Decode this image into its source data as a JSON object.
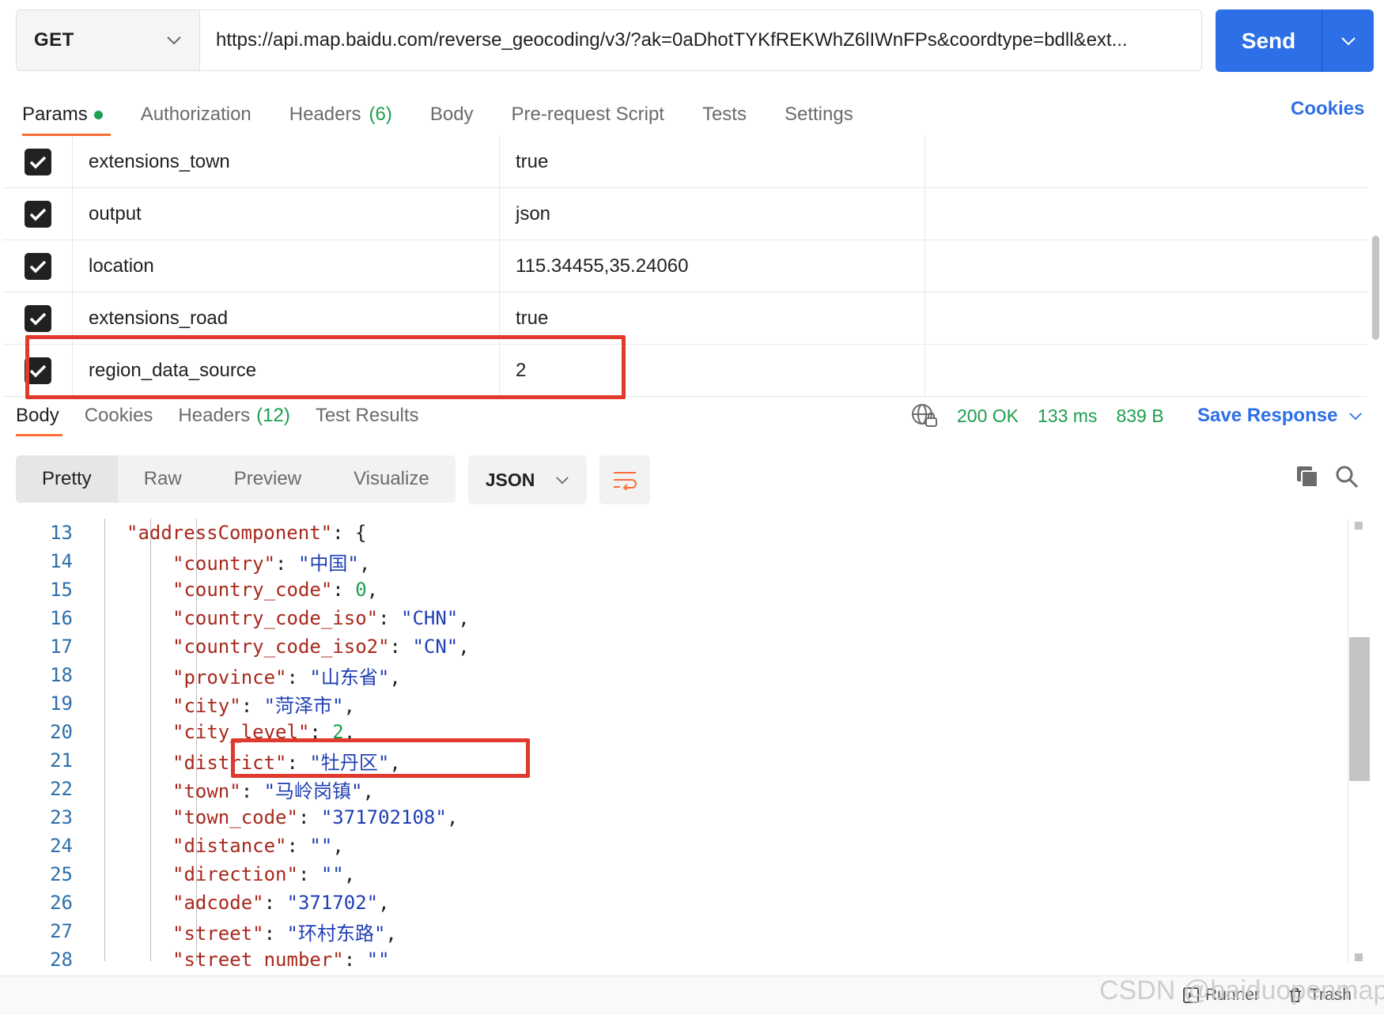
{
  "request": {
    "method": "GET",
    "url": "https://api.map.baidu.com/reverse_geocoding/v3/?ak=0aDhotTYKfREKWhZ6lIWnFPs&coordtype=bdll&ext...",
    "send_label": "Send"
  },
  "request_tabs": [
    {
      "label": "Params",
      "active": true
    },
    {
      "label": "Authorization"
    },
    {
      "label": "Headers",
      "count": "(6)"
    },
    {
      "label": "Body"
    },
    {
      "label": "Pre-request Script"
    },
    {
      "label": "Tests"
    },
    {
      "label": "Settings"
    }
  ],
  "cookies_link": "Cookies",
  "params": [
    {
      "key": "extensions_town",
      "value": "true",
      "checked": true
    },
    {
      "key": "output",
      "value": "json",
      "checked": true
    },
    {
      "key": "location",
      "value": "115.34455,35.24060",
      "checked": true
    },
    {
      "key": "extensions_road",
      "value": "true",
      "checked": true
    },
    {
      "key": "region_data_source",
      "value": "2",
      "checked": true
    }
  ],
  "response_tabs": [
    {
      "label": "Body",
      "active": true
    },
    {
      "label": "Cookies"
    },
    {
      "label": "Headers",
      "count": "(12)"
    },
    {
      "label": "Test Results"
    }
  ],
  "status": {
    "code": "200 OK",
    "time": "133 ms",
    "size": "839 B"
  },
  "save_response": "Save Response",
  "view_modes": [
    "Pretty",
    "Raw",
    "Preview",
    "Visualize"
  ],
  "format": "JSON",
  "code_lines": [
    {
      "n": "13",
      "indent": 2,
      "k": "addressComponent",
      "sep": ": {",
      "v": "",
      "vt": "",
      "tail": ""
    },
    {
      "n": "14",
      "indent": 3,
      "k": "country",
      "sep": ": ",
      "v": "中国",
      "vt": "s",
      "tail": ","
    },
    {
      "n": "15",
      "indent": 3,
      "k": "country_code",
      "sep": ": ",
      "v": "0",
      "vt": "n",
      "tail": ","
    },
    {
      "n": "16",
      "indent": 3,
      "k": "country_code_iso",
      "sep": ": ",
      "v": "CHN",
      "vt": "s",
      "tail": ","
    },
    {
      "n": "17",
      "indent": 3,
      "k": "country_code_iso2",
      "sep": ": ",
      "v": "CN",
      "vt": "s",
      "tail": ","
    },
    {
      "n": "18",
      "indent": 3,
      "k": "province",
      "sep": ": ",
      "v": "山东省",
      "vt": "s",
      "tail": ","
    },
    {
      "n": "19",
      "indent": 3,
      "k": "city",
      "sep": ": ",
      "v": "菏泽市",
      "vt": "s",
      "tail": ","
    },
    {
      "n": "20",
      "indent": 3,
      "k": "city_level",
      "sep": ": ",
      "v": "2",
      "vt": "n",
      "tail": ","
    },
    {
      "n": "21",
      "indent": 3,
      "k": "district",
      "sep": ": ",
      "v": "牡丹区",
      "vt": "s",
      "tail": ","
    },
    {
      "n": "22",
      "indent": 3,
      "k": "town",
      "sep": ": ",
      "v": "马岭岗镇",
      "vt": "s",
      "tail": ","
    },
    {
      "n": "23",
      "indent": 3,
      "k": "town_code",
      "sep": ": ",
      "v": "371702108",
      "vt": "s",
      "tail": ","
    },
    {
      "n": "24",
      "indent": 3,
      "k": "distance",
      "sep": ": ",
      "v": "",
      "vt": "s",
      "tail": ","
    },
    {
      "n": "25",
      "indent": 3,
      "k": "direction",
      "sep": ": ",
      "v": "",
      "vt": "s",
      "tail": ","
    },
    {
      "n": "26",
      "indent": 3,
      "k": "adcode",
      "sep": ": ",
      "v": "371702",
      "vt": "s",
      "tail": ","
    },
    {
      "n": "27",
      "indent": 3,
      "k": "street",
      "sep": ": ",
      "v": "环村东路",
      "vt": "s",
      "tail": ","
    },
    {
      "n": "28",
      "indent": 3,
      "k": "street_number",
      "sep": ": ",
      "v": "",
      "vt": "s",
      "tail": ""
    }
  ],
  "footer": {
    "runner": "Runner",
    "trash": "Trash"
  },
  "watermark": "CSDN @baiduopenmap",
  "colors": {
    "accent": "#2d6fe6",
    "highlight_box": "#e03a2f",
    "tab_underline": "#ff6c37",
    "status_ok": "#1c9e4f"
  }
}
